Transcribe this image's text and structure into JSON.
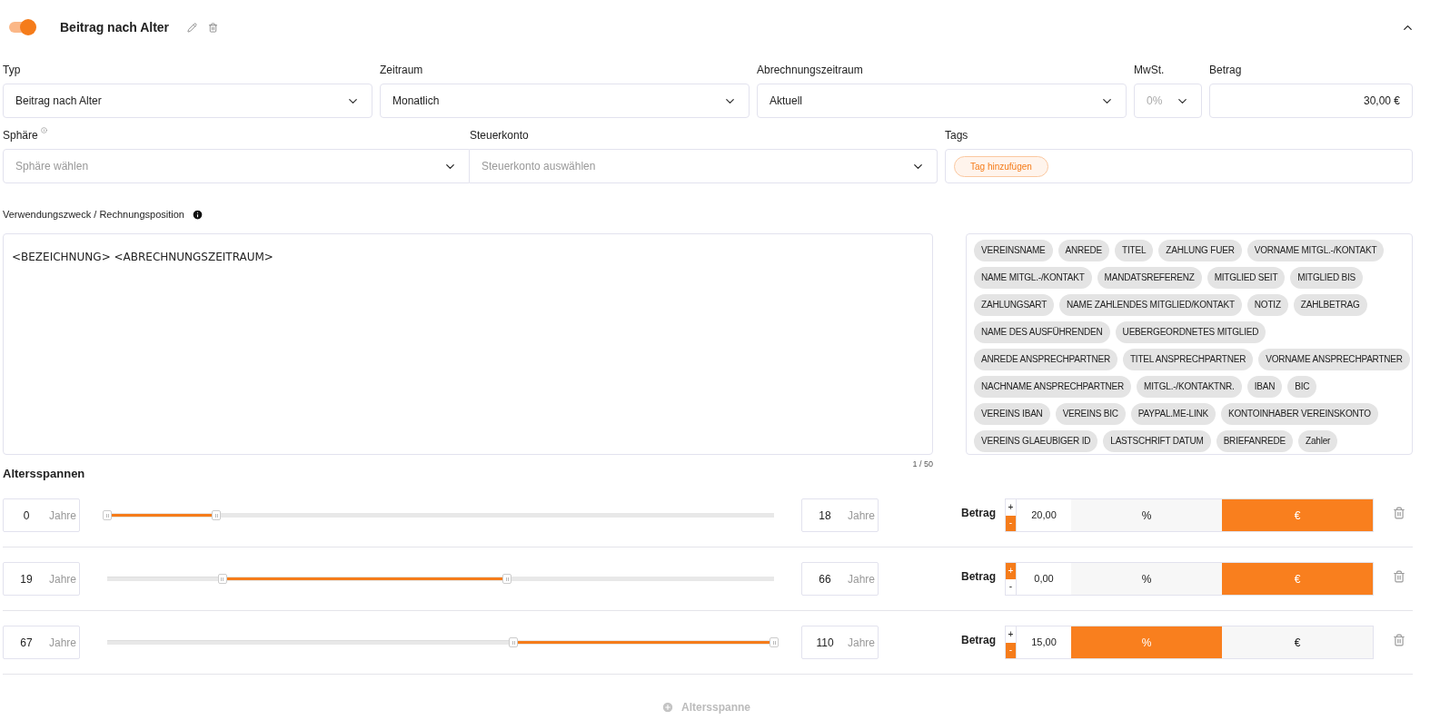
{
  "header": {
    "enabled": true,
    "title": "Beitrag nach Alter",
    "expanded": true
  },
  "fields_row_1": [
    {
      "kind": "select",
      "label": "Typ",
      "value": "Beitrag nach Alter"
    },
    {
      "kind": "select",
      "label": "Zeitraum",
      "value": "Monatlich"
    },
    {
      "kind": "select",
      "label": "Abrechnungszeitraum",
      "value": "Aktuell"
    },
    {
      "kind": "select",
      "label": "MwSt.",
      "value": "0%",
      "disabled": true
    },
    {
      "kind": "amount",
      "label": "Betrag",
      "value": "30,00 €"
    }
  ],
  "sphere": {
    "label": "Sphäre",
    "placeholder": "Sphäre wählen"
  },
  "tax_account": {
    "label": "Steuerkonto",
    "placeholder": "Steuerkonto auswählen"
  },
  "tags": {
    "label": "Tags",
    "add_button": "Tag hinzufügen"
  },
  "purpose": {
    "label": "Verwendungszweck / Rechnungsposition",
    "value": "<BEZEICHNUNG> <ABRECHNUNGSZEITRAUM>",
    "counter": "1 / 50"
  },
  "placeholder_rows": [
    [
      "VEREINSNAME",
      "ANREDE",
      "TITEL",
      "ZAHLUNG FUER",
      "VORNAME MITGL.-/KONTAKT"
    ],
    [
      "NAME MITGL.-/KONTAKT",
      "MANDATSREFERENZ",
      "MITGLIED SEIT",
      "MITGLIED BIS"
    ],
    [
      "ZAHLUNGSART",
      "NAME ZAHLENDES MITGLIED/KONTAKT",
      "NOTIZ",
      "ZAHLBETRAG"
    ],
    [
      "NAME DES AUSFÜHRENDEN",
      "UEBERGEORDNETES MITGLIED"
    ],
    [
      "ANREDE ANSPRECHPARTNER",
      "TITEL ANSPRECHPARTNER",
      "VORNAME ANSPRECHPARTNER"
    ],
    [
      "NACHNAME ANSPRECHPARTNER",
      "MITGL.-/KONTAKTNR.",
      "IBAN",
      "BIC"
    ],
    [
      "VEREINS IBAN",
      "VEREINS BIC",
      "PAYPAL.ME-LINK",
      "KONTOINHABER VEREINSKONTO"
    ],
    [
      "VEREINS GLAEUBIGER ID",
      "LASTSCHRIFT DATUM",
      "BRIEFANREDE",
      "Zahler"
    ]
  ],
  "age_ranges": {
    "title": "Altersspannen",
    "rows": [
      {
        "from": "0",
        "from_unit": "Jahre",
        "thumbs": [
          {
            "level": 0
          },
          {
            "level": 0.164
          }
        ],
        "to": "18",
        "to_unit": "Jahre",
        "amount_label": "Betrag",
        "signs": [
          {
            "label": "+",
            "selected": false
          },
          {
            "label": "-",
            "selected": true
          }
        ],
        "amount": "20,00",
        "units": [
          {
            "label": "%",
            "selected": false
          },
          {
            "label": "€",
            "selected": true
          }
        ]
      },
      {
        "from": "19",
        "from_unit": "Jahre",
        "thumbs": [
          {
            "level": 0.173
          },
          {
            "level": 0.6
          }
        ],
        "to": "66",
        "to_unit": "Jahre",
        "amount_label": "Betrag",
        "signs": [
          {
            "label": "+",
            "selected": true
          },
          {
            "label": "-",
            "selected": false
          }
        ],
        "amount": "0,00",
        "units": [
          {
            "label": "%",
            "selected": false
          },
          {
            "label": "€",
            "selected": true
          }
        ]
      },
      {
        "from": "67",
        "from_unit": "Jahre",
        "thumbs": [
          {
            "level": 0.609
          },
          {
            "level": 1
          }
        ],
        "to": "110",
        "to_unit": "Jahre",
        "amount_label": "Betrag",
        "signs": [
          {
            "label": "+",
            "selected": false
          },
          {
            "label": "-",
            "selected": true
          }
        ],
        "amount": "15,00",
        "units": [
          {
            "label": "%",
            "selected": true
          },
          {
            "label": "€",
            "selected": false
          }
        ]
      }
    ],
    "add_button": "Altersspanne"
  }
}
